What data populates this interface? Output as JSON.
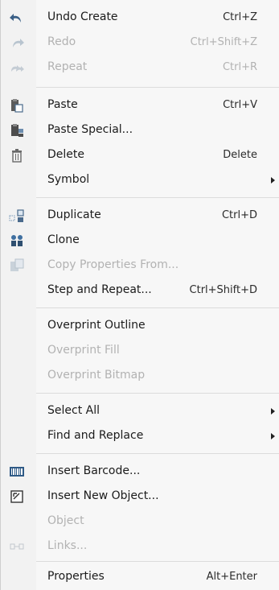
{
  "menu": {
    "items": [
      {
        "label": "Undo Create",
        "shortcut": "Ctrl+Z",
        "enabled": true,
        "icon": "undo-icon"
      },
      {
        "label": "Redo",
        "shortcut": "Ctrl+Shift+Z",
        "enabled": false,
        "icon": "redo-icon"
      },
      {
        "label": "Repeat",
        "shortcut": "Ctrl+R",
        "enabled": false,
        "icon": "repeat-icon"
      },
      {
        "label": "Paste",
        "shortcut": "Ctrl+V",
        "enabled": true,
        "icon": "paste-icon"
      },
      {
        "label": "Paste Special...",
        "shortcut": "",
        "enabled": true,
        "icon": "paste-special-icon"
      },
      {
        "label": "Delete",
        "shortcut": "Delete",
        "enabled": true,
        "icon": "trash-icon"
      },
      {
        "label": "Symbol",
        "shortcut": "",
        "enabled": true,
        "icon": "",
        "submenu": true
      },
      {
        "label": "Duplicate",
        "shortcut": "Ctrl+D",
        "enabled": true,
        "icon": "duplicate-icon"
      },
      {
        "label": "Clone",
        "shortcut": "",
        "enabled": true,
        "icon": "clone-icon"
      },
      {
        "label": "Copy Properties From...",
        "shortcut": "",
        "enabled": false,
        "icon": "copy-properties-icon"
      },
      {
        "label": "Step and Repeat...",
        "shortcut": "Ctrl+Shift+D",
        "enabled": true,
        "icon": ""
      },
      {
        "label": "Overprint Outline",
        "shortcut": "",
        "enabled": true,
        "icon": ""
      },
      {
        "label": "Overprint Fill",
        "shortcut": "",
        "enabled": false,
        "icon": ""
      },
      {
        "label": "Overprint Bitmap",
        "shortcut": "",
        "enabled": false,
        "icon": ""
      },
      {
        "label": "Select All",
        "shortcut": "",
        "enabled": true,
        "icon": "",
        "submenu": true
      },
      {
        "label": "Find and Replace",
        "shortcut": "",
        "enabled": true,
        "icon": "",
        "submenu": true
      },
      {
        "label": "Insert Barcode...",
        "shortcut": "",
        "enabled": true,
        "icon": "barcode-icon"
      },
      {
        "label": "Insert New Object...",
        "shortcut": "",
        "enabled": true,
        "icon": "insert-object-icon"
      },
      {
        "label": "Object",
        "shortcut": "",
        "enabled": false,
        "icon": ""
      },
      {
        "label": "Links...",
        "shortcut": "",
        "enabled": false,
        "icon": "links-icon"
      },
      {
        "label": "Properties",
        "shortcut": "Alt+Enter",
        "enabled": true,
        "icon": ""
      }
    ]
  },
  "colors": {
    "menu_background": "#f7f7f7",
    "enabled_text": "#1b1b1b",
    "disabled_text": "#b2b2b2",
    "separator": "#dcdcdc"
  }
}
